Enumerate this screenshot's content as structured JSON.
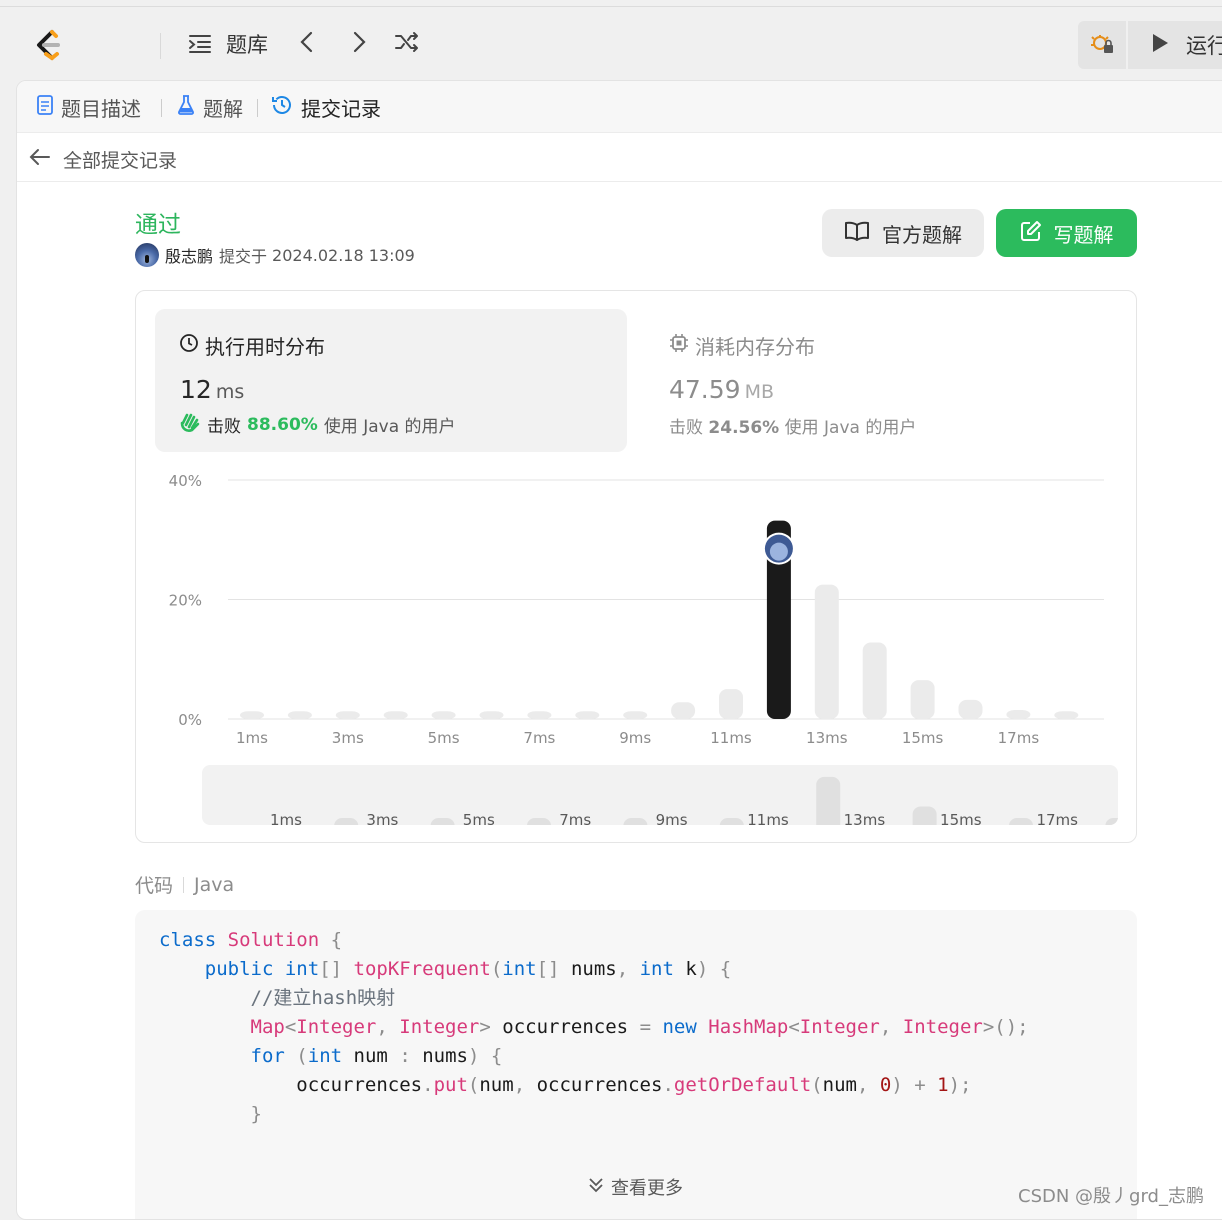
{
  "topbar": {
    "problem_list_label": "题库",
    "run_label": "运行"
  },
  "tabs": [
    {
      "label": "题目描述",
      "icon": "document-icon"
    },
    {
      "label": "题解",
      "icon": "flask-icon"
    },
    {
      "label": "提交记录",
      "icon": "history-icon",
      "active": true
    }
  ],
  "subheader": {
    "back_label": "全部提交记录"
  },
  "submission": {
    "status": "通过",
    "author": "殷志鹏",
    "submitted_prefix": "提交于",
    "submitted_at": "2024.02.18 13:09",
    "official_solution_label": "官方题解",
    "write_solution_label": "写题解"
  },
  "runtime": {
    "title": "执行用时分布",
    "value": "12",
    "unit": "ms",
    "beat_prefix": "击败",
    "beat_pct": "88.60%",
    "beat_suffix": "使用 Java 的用户"
  },
  "memory": {
    "title": "消耗内存分布",
    "value": "47.59",
    "unit": "MB",
    "beat_prefix": "击败",
    "beat_pct": "24.56%",
    "beat_suffix": "使用 Java 的用户"
  },
  "chart_data": {
    "type": "bar",
    "ylabel_ticks": [
      "40%",
      "20%",
      "0%"
    ],
    "ylim": [
      0,
      40
    ],
    "categories": [
      "1ms",
      "2ms",
      "3ms",
      "4ms",
      "5ms",
      "6ms",
      "7ms",
      "8ms",
      "9ms",
      "10ms",
      "11ms",
      "12ms",
      "13ms",
      "14ms",
      "15ms",
      "16ms",
      "17ms",
      "18ms"
    ],
    "x_tick_labels": [
      "1ms",
      "3ms",
      "5ms",
      "7ms",
      "9ms",
      "11ms",
      "13ms",
      "15ms",
      "17ms"
    ],
    "values": [
      1.3,
      1.3,
      1.3,
      1.3,
      1.3,
      1.3,
      1.3,
      1.3,
      1.3,
      2.8,
      5.0,
      33.2,
      22.5,
      12.8,
      6.5,
      3.2,
      1.5,
      1.3
    ],
    "highlight_category": "12ms",
    "grid": true,
    "mini_x_tick_labels": [
      "1ms",
      "3ms",
      "5ms",
      "7ms",
      "9ms",
      "11ms",
      "13ms",
      "15ms",
      "17ms"
    ]
  },
  "code": {
    "label": "代码",
    "language": "Java",
    "view_more_label": "查看更多",
    "lines": [
      "class Solution {",
      "    public int[] topKFrequent(int[] nums, int k) {",
      "        //建立hash映射",
      "        Map<Integer, Integer> occurrences = new HashMap<Integer, Integer>();",
      "        for (int num : nums) {",
      "            occurrences.put(num, occurrences.getOrDefault(num, 0) + 1);",
      "        }"
    ]
  },
  "watermark": "CSDN @殷丿grd_志鹏",
  "colors": {
    "accent_green": "#2cbb5d",
    "highlight_bar": "#1a1a1a",
    "bar": "#ebebeb"
  }
}
